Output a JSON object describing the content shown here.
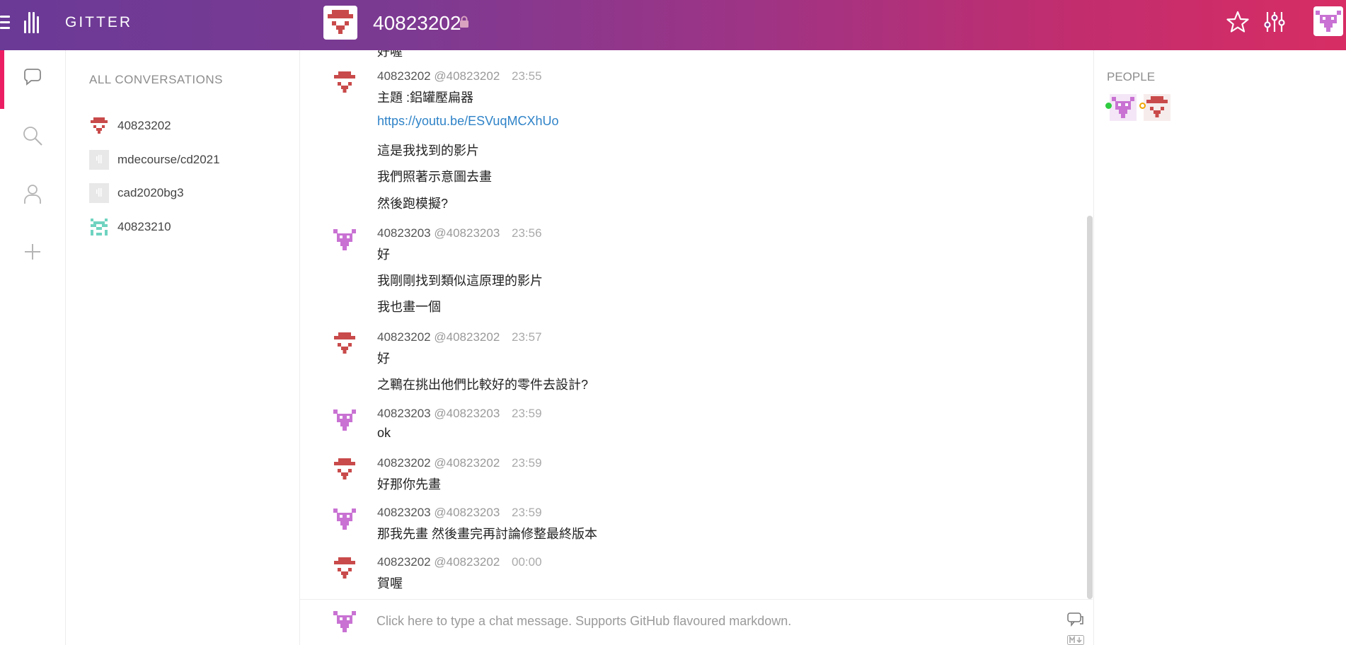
{
  "header": {
    "app_name": "GITTER",
    "room_name": "40823202",
    "icons": [
      "menu-icon",
      "gitter-logo-icon",
      "lock-icon",
      "star-icon",
      "settings-sliders-icon"
    ]
  },
  "rail": {
    "icons": [
      "conversations-icon",
      "search-icon",
      "people-icon",
      "add-icon"
    ]
  },
  "conversations": {
    "title": "ALL CONVERSATIONS",
    "items": [
      {
        "name": "40823202"
      },
      {
        "name": "mdecourse/cd2021"
      },
      {
        "name": "cad2020bg3"
      },
      {
        "name": "40823210"
      }
    ]
  },
  "messages": [
    {
      "name": "40823202",
      "username": "@40823202",
      "time": "23:55",
      "lines": [
        "主題 :鋁罐壓扁器",
        "https://youtu.be/ESVuqMCXhUo",
        "這是我找到的影片",
        "我們照著示意圖去畫",
        "然後跑模擬?"
      ]
    },
    {
      "name": "40823203",
      "username": "@40823203",
      "time": "23:56",
      "lines": [
        "好",
        "我剛剛找到類似這原理的影片",
        "我也畫一個"
      ]
    },
    {
      "name": "40823202",
      "username": "@40823202",
      "time": "23:57",
      "lines": [
        "好",
        "之鶤在挑出他們比較好的零件去設計?"
      ]
    },
    {
      "name": "40823203",
      "username": "@40823203",
      "time": "23:59",
      "lines": [
        "ok"
      ]
    },
    {
      "name": "40823202",
      "username": "@40823202",
      "time": "23:59",
      "lines": [
        "好那你先畫"
      ]
    },
    {
      "name": "40823203",
      "username": "@40823203",
      "time": "23:59",
      "lines": [
        "那我先畫 然後畫完再討論修整最終版本"
      ]
    },
    {
      "name": "40823202",
      "username": "@40823202",
      "time": "00:00",
      "lines": [
        "賀喔"
      ]
    }
  ],
  "input": {
    "placeholder": "Click here to type a chat message. Supports GitHub flavoured markdown."
  },
  "people": {
    "title": "PEOPLE"
  },
  "colors": {
    "header_gradient_start": "#6a3a96",
    "header_gradient_end": "#d72d64",
    "active_indicator": "#ec1e63",
    "link": "#2f83c8",
    "online": "#2ecc40",
    "away": "#f0a500"
  }
}
